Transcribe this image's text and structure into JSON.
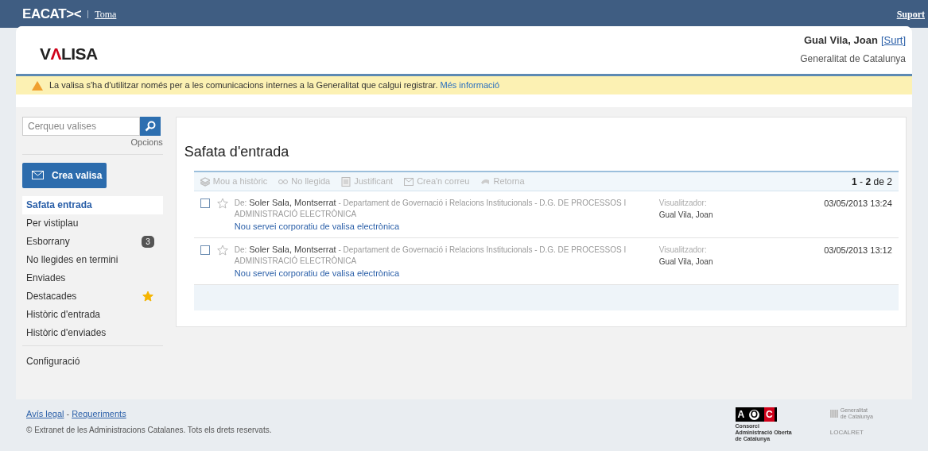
{
  "top_bar": {
    "brand": "EACAT><",
    "link": "Toma",
    "support": "Suport"
  },
  "header": {
    "logo_parts": [
      "V",
      "Λ",
      "LISA"
    ],
    "user": "Gual Vila, Joan",
    "logout": "Surt",
    "logout_brackets": [
      "[",
      "]"
    ],
    "organization": "Generalitat de Catalunya"
  },
  "notice": {
    "text": "La valisa s'ha d'utilitzar només per a les comunicacions internes a la Generalitat que calgui registrar.",
    "link": "Més informació"
  },
  "sidebar": {
    "search_placeholder": "Cerqueu valises",
    "options": "Opcions",
    "create_button": "Crea valisa",
    "items": [
      {
        "label": "Safata entrada",
        "selected": true,
        "starred": false
      },
      {
        "label": "Per vistiplau",
        "selected": false,
        "starred": false
      },
      {
        "label": "Esborrany",
        "selected": false,
        "starred": false,
        "badge": "3"
      },
      {
        "label": "No llegides en termini",
        "selected": false,
        "starred": false
      },
      {
        "label": "Enviades",
        "selected": false,
        "starred": false
      },
      {
        "label": "Destacades",
        "selected": false,
        "starred": true
      },
      {
        "label": "Històric d'entrada",
        "selected": false,
        "starred": false
      },
      {
        "label": "Històric d'enviades",
        "selected": false,
        "starred": false
      }
    ],
    "settings": "Configuració"
  },
  "inbox": {
    "title": "Safata d'entrada",
    "actions": [
      {
        "kind": "stack",
        "label": "Mou a històric",
        "disabled": true
      },
      {
        "kind": "glasses",
        "label": "No llegida",
        "disabled": true
      },
      {
        "kind": "document",
        "label": "Justificant",
        "disabled": true
      },
      {
        "kind": "envelope",
        "label": "Crea'n correu",
        "disabled": true
      },
      {
        "kind": "return",
        "label": "Retorna",
        "disabled": true
      }
    ],
    "pagination": "**1** - **2** de 2",
    "messages": [
      {
        "checked": false,
        "starred": false,
        "from_label": "De:",
        "sender": "Soler Sala, Montserrat",
        "department": "- Departament de Governació i Relacions Institucionals - D.G. DE PROCESSOS I ADMINISTRACIÓ ELECTRÒNICA",
        "subject": "Nou servei corporatiu de valisa electrònica",
        "viewer_label": "Visualitzador:",
        "viewer": "Gual Vila, Joan",
        "date": "03/05/2013 13:24"
      },
      {
        "checked": false,
        "starred": false,
        "from_label": "De:",
        "sender": "Soler Sala, Montserrat",
        "department": "- Departament de Governació i Relacions Institucionals - D.G. DE PROCESSOS I ADMINISTRACIÓ ELECTRÒNICA",
        "subject": "Nou servei corporatiu de valisa electrònica",
        "viewer_label": "Visualitzador:",
        "viewer": "Gual Vila, Joan",
        "date": "03/05/2013 13:12"
      }
    ]
  },
  "footer": {
    "links": [
      "Avís legal",
      "Requeriments"
    ],
    "separator": "-",
    "copyright": "© Extranet de les Administracions Catalanes. Tots els drets reservats.",
    "aoc_letters": [
      "A",
      "O",
      "C"
    ],
    "aoc_caption": [
      "Consorci",
      "Administració Oberta",
      "de Catalunya"
    ],
    "generalitat": [
      "Generalitat",
      "de Catalunya"
    ],
    "localret": "LOCALRET"
  }
}
